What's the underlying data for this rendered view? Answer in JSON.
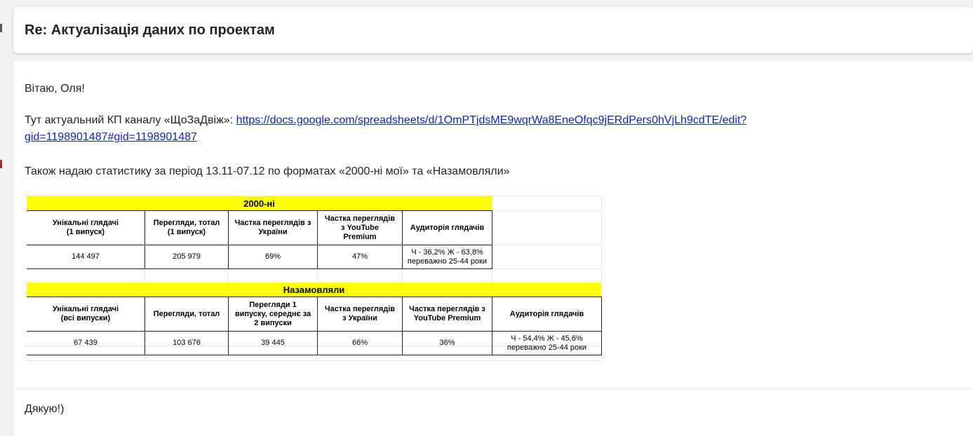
{
  "email": {
    "subject": "Re: Актуалізація даних по проектам",
    "greeting": "Вітаю, Оля!",
    "kp_text": "Тут актуальний КП каналу «ЩоЗаДвіж»: ",
    "kp_link_line1": "https://docs.google.com/spreadsheets/d/1OmPTjdsME9wqrWa8EneOfqc9jERdPers0hVjLh9cdTE/edit?",
    "kp_link_line2": "gid=1198901487#gid=1198901487",
    "stats_text": "Також надаю статистику за період 13.11-07.12 по форматах «2000-ні мої» та «Назамовляли»",
    "closing": "Дякую!)"
  },
  "tables": {
    "t1": {
      "title": "2000-ні",
      "headers": [
        "Унікальні глядачі\n(1 випуск)",
        "Перегляди, тотал\n(1 випуск)",
        "Частка переглядів з\nУкраїни",
        "Частка переглядів\nз YouTube\nPremium",
        "Аудиторія глядачів"
      ],
      "values": [
        "144 497",
        "205 979",
        "69%",
        "47%",
        "Ч - 36,2% Ж - 63,8%\nпереважно 25-44 роки"
      ]
    },
    "t2": {
      "title": "Назамовляли",
      "headers": [
        "Унікальні глядачі\n(всі випуски)",
        "Перегляди, тотал",
        "Перегляди 1\nвипуску, середнє за\n2 випуски",
        "Частка переглядів\nз України",
        "Частка переглядів з\nYouTube Premium",
        "Аудиторія глядачів"
      ],
      "values": [
        "67 439",
        "103 676",
        "39 445",
        "66%",
        "36%",
        "Ч - 54,4% Ж - 45,6%\nпереважно 25-44 роки"
      ]
    }
  },
  "colors": {
    "highlight": "#ffff00",
    "link": "#0b23c9"
  }
}
